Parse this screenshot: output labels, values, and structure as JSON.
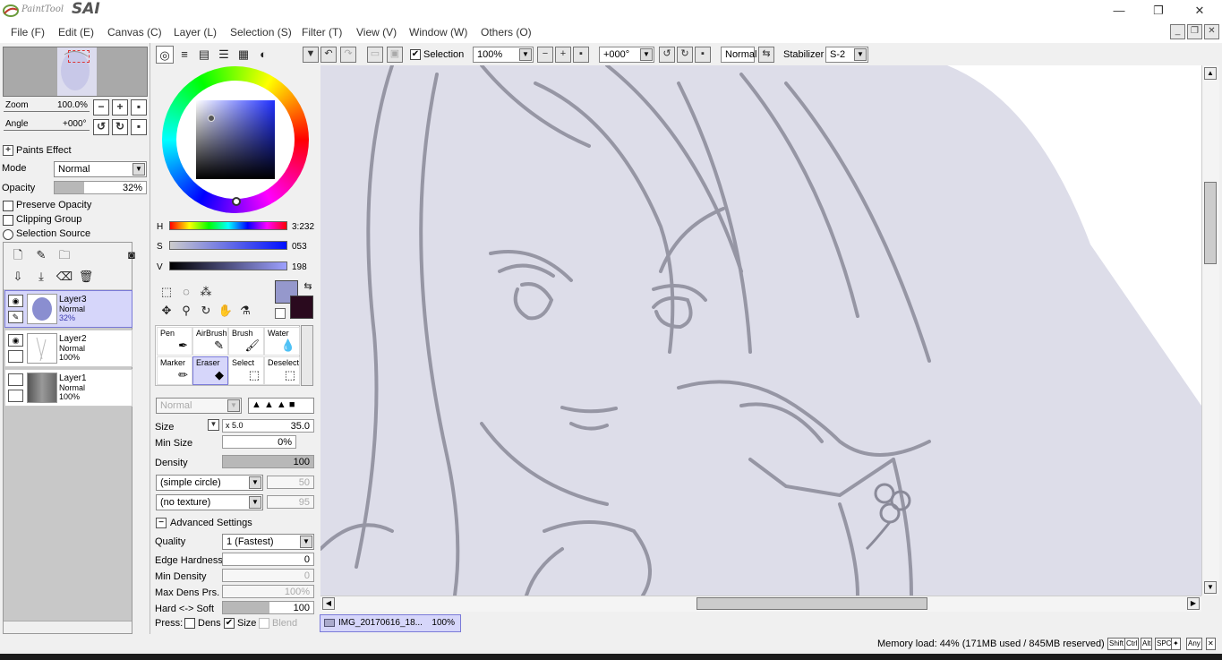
{
  "app": {
    "logo_small": "PaintTool",
    "logo_big": "SAI"
  },
  "window_buttons": {
    "minimize": "—",
    "restore": "❐",
    "close": "✕"
  },
  "menu": [
    "File (F)",
    "Edit (E)",
    "Canvas (C)",
    "Layer (L)",
    "Selection (S)",
    "Filter (T)",
    "View (V)",
    "Window (W)",
    "Others (O)"
  ],
  "navigator": {
    "zoom_label": "Zoom",
    "zoom_value": "100.0%",
    "angle_label": "Angle",
    "angle_value": "+000°"
  },
  "layer_props": {
    "paints_effect": "Paints Effect",
    "mode_label": "Mode",
    "mode_value": "Normal",
    "opacity_label": "Opacity",
    "opacity_value": "32%",
    "opacity_fraction": 0.32,
    "preserve_opacity": "Preserve Opacity",
    "clipping_group": "Clipping Group",
    "selection_source": "Selection Source"
  },
  "layers": [
    {
      "name": "Layer3",
      "mode": "Normal",
      "opacity": "32%"
    },
    {
      "name": "Layer2",
      "mode": "Normal",
      "opacity": "100%"
    },
    {
      "name": "Layer1",
      "mode": "Normal",
      "opacity": "100%"
    }
  ],
  "color": {
    "h_label": "H",
    "h_value": "3:232",
    "s_label": "S",
    "s_value": "053",
    "v_label": "V",
    "v_value": "198",
    "fg": "#9598cc",
    "bg": "#2a0a1e"
  },
  "brushes": [
    {
      "name": "Pen",
      "icon": "✒"
    },
    {
      "name": "AirBrush",
      "icon": "✎"
    },
    {
      "name": "Brush",
      "icon": "🖌"
    },
    {
      "name": "Water",
      "icon": "💧"
    },
    {
      "name": "Marker",
      "icon": "✏"
    },
    {
      "name": "Eraser",
      "icon": "◆"
    },
    {
      "name": "Select",
      "icon": "⬚"
    },
    {
      "name": "Deselect",
      "icon": "⬚"
    }
  ],
  "brush_settings": {
    "blend_mode": "Normal",
    "size_label": "Size",
    "size_mult": "x 5.0",
    "size_value": "35.0",
    "min_size_label": "Min Size",
    "min_size_value": "0%",
    "density_label": "Density",
    "density_value": "100",
    "shape": "(simple circle)",
    "shape_value": "50",
    "texture": "(no texture)",
    "texture_value": "95",
    "advanced": "Advanced Settings",
    "quality_label": "Quality",
    "quality_value": "1 (Fastest)",
    "edge_label": "Edge Hardness",
    "edge_value": "0",
    "min_density_label": "Min Density",
    "min_density_value": "0",
    "max_dens_label": "Max Dens Prs.",
    "max_dens_value": "100%",
    "hard_soft_label": "Hard <-> Soft",
    "hard_soft_value": "100",
    "press_label": "Press:",
    "dens": "Dens",
    "size": "Size",
    "blend": "Blend"
  },
  "toolbar": {
    "selection_label": "Selection",
    "zoom": "100%",
    "angle": "+000°",
    "blend": "Normal",
    "stabilizer_label": "Stabilizer",
    "stabilizer_value": "S-2"
  },
  "document_tab": {
    "name": "IMG_20170616_18...",
    "zoom": "100%"
  },
  "status": {
    "memory": "Memory load: 44% (171MB used / 845MB reserved)",
    "keys": [
      "Shift",
      "Ctrl",
      "Alt",
      "SPC",
      "✦",
      "Any"
    ]
  }
}
